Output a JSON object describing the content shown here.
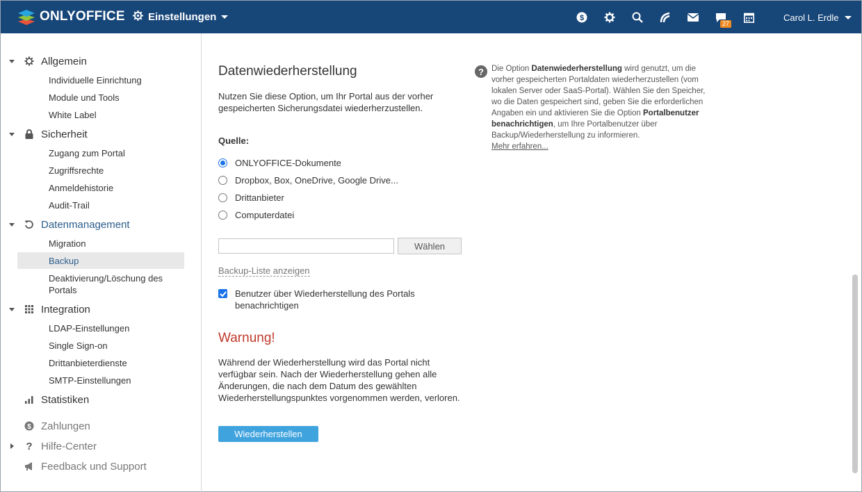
{
  "header": {
    "logo_text": "ONLYOFFICE",
    "module_label": "Einstellungen",
    "icons": [
      "payment-icon",
      "settings-icon",
      "search-icon",
      "feed-icon",
      "mail-icon",
      "chat-icon",
      "calendar-icon"
    ],
    "chat_badge": "27",
    "user_name": "Carol L. Erdle"
  },
  "sidebar": {
    "sections": [
      {
        "label": "Allgemein",
        "items": [
          "Individuelle Einrichtung",
          "Module und Tools",
          "White Label"
        ]
      },
      {
        "label": "Sicherheit",
        "items": [
          "Zugang zum Portal",
          "Zugriffsrechte",
          "Anmeldehistorie",
          "Audit-Trail"
        ]
      },
      {
        "label": "Datenmanagement",
        "items": [
          "Migration",
          "Backup",
          "Deaktivierung/Löschung des Portals"
        ]
      },
      {
        "label": "Integration",
        "items": [
          "LDAP-Einstellungen",
          "Single Sign-on",
          "Drittanbieterdienste",
          "SMTP-Einstellungen"
        ]
      },
      {
        "label": "Statistiken",
        "items": []
      }
    ],
    "extra": [
      "Zahlungen",
      "Hilfe-Center",
      "Feedback und Support"
    ],
    "selected_item": "Backup"
  },
  "main": {
    "title": "Datenwiederherstellung",
    "description": "Nutzen Sie diese Option, um Ihr Portal aus der vorher gespeicherten Sicherungsdatei wiederherzustellen.",
    "source_label": "Quelle:",
    "sources": [
      "ONLYOFFICE-Dokumente",
      "Dropbox, Box, OneDrive, Google Drive...",
      "Drittanbieter",
      "Computerdatei"
    ],
    "selected_source": "ONLYOFFICE-Dokumente",
    "file_input_value": "",
    "choose_button": "Wählen",
    "backup_list_link": "Backup-Liste anzeigen",
    "notify_checkbox_label": "Benutzer über Wiederherstellung des Portals benachrichtigen",
    "notify_checked": true,
    "warning_title": "Warnung!",
    "warning_text": "Während der Wiederherstellung wird das Portal nicht verfügbar sein. Nach der Wiederherstellung gehen alle Änderungen, die nach dem Datum des gewählten Wiederherstellungspunktes vorgenommen werden, verloren.",
    "restore_button": "Wiederherstellen"
  },
  "help": {
    "part1": "Die Option ",
    "bold1": "Datenwiederherstellung",
    "part2": " wird genutzt, um die vorher gespeicherten Portaldaten wiederherzustellen (vom lokalen Server oder SaaS-Portal). Wählen Sie den Speicher, wo die Daten gespeichert sind, geben Sie die erforderlichen Angaben ein und aktivieren Sie die Option ",
    "bold2": "Portalbenutzer benachrichtigen",
    "part3": ", um Ihre Portalbenutzer über Backup/Wiederherstellung zu informieren.",
    "link": "Mehr erfahren..."
  },
  "colors": {
    "header_bg": "#174679",
    "accent": "#3fa3de",
    "warning": "#c0392b",
    "active_link": "#2c5d8b"
  }
}
